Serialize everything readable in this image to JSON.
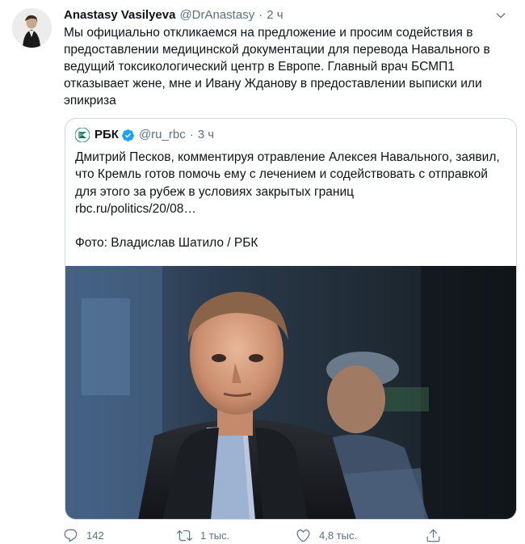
{
  "tweet": {
    "author_name": "Anastasy Vasilyeva",
    "author_handle": "@DrAnastasy",
    "separator": "·",
    "timestamp": "2 ч",
    "text": "Мы официально откликаемся на предложение и просим содействия в предоставлении медицинской документации для перевода Навального в ведущий токсикологический центр в Европе. Главный врач БСМП1 отказывает жене, мне и Ивану Жданову в предоставлении выписки или эпикриза"
  },
  "quoted_tweet": {
    "author_name": "РБК",
    "author_handle": "@ru_rbc",
    "separator": "·",
    "timestamp": "3 ч",
    "text": "Дмитрий Песков, комментируя отравление Алексея Навального, заявил, что Кремль готов помочь ему с лечением и содействовать с отправкой для этого за рубеж в условиях закрытых границ\nrbc.ru/politics/20/08…\n\nФото: Владислав Шатило / РБК",
    "logo_colors": [
      "#2b8a6e",
      "#ffffff"
    ]
  },
  "actions": {
    "reply_count": "142",
    "retweet_count": "1 тыс.",
    "like_count": "4,8 тыс."
  },
  "icons": {
    "reply": "reply-icon",
    "retweet": "retweet-icon",
    "like": "heart-icon",
    "share": "share-icon",
    "caret": "chevron-down-icon",
    "verified": "verified-badge-icon"
  },
  "colors": {
    "text_primary": "#0f1419",
    "text_secondary": "#5b7083",
    "verified_blue": "#1da1f2",
    "border": "#cfd9de"
  }
}
